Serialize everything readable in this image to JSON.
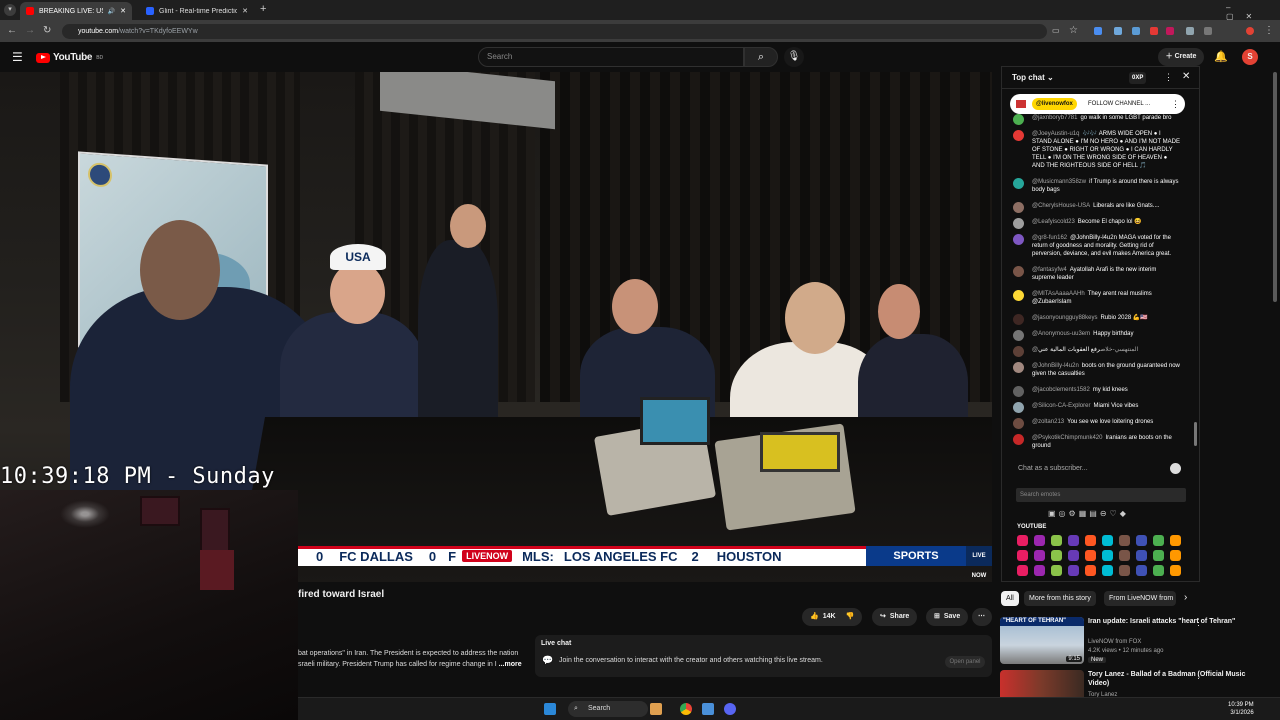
{
  "browser": {
    "tabs": [
      {
        "label": "BREAKING LIVE: US strikes I",
        "active": true,
        "audio": "🔊"
      },
      {
        "label": "Glint - Real-time Prediction Ma",
        "active": false
      }
    ],
    "new_tab": "+",
    "url_host": "youtube.com",
    "url_path": "/watch?v=TKdyfoEEWYw"
  },
  "youtube": {
    "logo_text": "YouTube",
    "logo_sup": "BD",
    "search_placeholder": "Search",
    "create_label": "Create",
    "avatar_letter": "S"
  },
  "video": {
    "overlay_time": "10:39:18 PM - Sunday",
    "ticker": {
      "items": [
        "0",
        "FC DALLAS",
        "0",
        "F",
        "MLS:",
        "LOS ANGELES FC",
        "2",
        "HOUSTON"
      ],
      "network": "LIVENOW",
      "sports": "SPORTS",
      "bug": "LIVE NOW"
    },
    "cap_text": "USA"
  },
  "below_video": {
    "title_fragment": "fired toward Israel",
    "actions": {
      "likes": "14K",
      "share": "Share",
      "save": "Save"
    },
    "description_line1": "bat operations\" in Iran. The President is expected to address the nation",
    "description_line2": "sraeli military. President Trump has called for regime change in I",
    "more": "...more",
    "live_chat_title": "Live chat",
    "live_chat_text": "Join the conversation to interact with the creator and others watching this live stream.",
    "open_panel": "Open panel"
  },
  "chat": {
    "header": "Top chat",
    "xp": "0XP",
    "pinned_user": "@livenowfox",
    "pinned_label": "FOLLOW CHANNEL ...",
    "messages": [
      {
        "user": "@jaxnboryb7781",
        "text": "go walk in some LGBT parade bro",
        "color": "#4caf50"
      },
      {
        "user": "@JoeyAustin-u1q",
        "text": "🎶🎶 ARMS WIDE OPEN ● I STAND ALONE ● I'M NO HERO ● AND I'M NOT MADE OF STONE ● RIGHT OR WRONG ● I CAN HARDLY TELL ● I'M ON THE WRONG SIDE OF HEAVEN ● AND THE RIGHTEOUS SIDE OF HELL 🎵",
        "color": "#e53935"
      },
      {
        "user": "@Musicmann358zw",
        "text": "if Trump is around there is always body bags",
        "color": "#26a69a"
      },
      {
        "user": "@CherylsHouse-USA",
        "text": "Liberals are like Gnats....",
        "color": "#8d6e63"
      },
      {
        "user": "@Leafyiscold23",
        "text": "Become El chapo lol 😆",
        "color": "#9e9e9e"
      },
      {
        "user": "@gr8-fun162",
        "text": "@JohnBilly-l4u2n MAGA voted for the return of goodness and morality. Getting rid of perversion, deviance, and evil makes America great.",
        "color": "#7e57c2"
      },
      {
        "user": "@fantasyfw4",
        "text": "Ayatollah Arafi is the new interim supreme leader",
        "color": "#795548"
      },
      {
        "user": "@MITAsAaaaAAHh",
        "text": "They arent real muslims @ZubaerIslam",
        "color": "#fdd835"
      },
      {
        "user": "@jasonyoungguy88keys",
        "text": "Rubio 2028 💪🇺🇸",
        "color": "#3e2723"
      },
      {
        "user": "@Anonymous-uu3em",
        "text": "Happy birthday",
        "color": "#757575"
      },
      {
        "user": "@المنتهسي-خلاص",
        "text": "رفع العقوبات المالية عني",
        "color": "#5d4037"
      },
      {
        "user": "@JohnBilly-l4u2n",
        "text": "boots on the ground guaranteed now given the casualties",
        "color": "#a1887f"
      },
      {
        "user": "@jacobclements1582",
        "text": "my kid knees",
        "color": "#616161"
      },
      {
        "user": "@Silicon-CA-Explorer",
        "text": "Miami Vice vibes",
        "color": "#90a4ae"
      },
      {
        "user": "@zoltan213",
        "text": "You see we love loitering drones",
        "color": "#6d4c41"
      },
      {
        "user": "@PsykotikChimpmunk420",
        "text": "Iranians are boots on the ground",
        "color": "#c62828"
      }
    ],
    "input_placeholder": "Chat as a subscriber...",
    "emote_search": "Search emotes",
    "emote_section": "YOUTUBE"
  },
  "sidebar": {
    "chips": [
      "All",
      "More from this story",
      "From LiveNOW from"
    ],
    "recommendations": [
      {
        "title": "Iran update: Israeli attacks \"heart of Tehran\"",
        "channel": "LiveNOW from FOX",
        "meta": "4.2K views • 12 minutes ago",
        "badge": "New",
        "duration": "9:15",
        "thumb_text": "\"HEART OF TEHRAN\""
      },
      {
        "title": "Tory Lanez - Ballad of a Badman (Official Music Video)",
        "channel": "Tory Lanez",
        "meta": "",
        "badge": "",
        "duration": "",
        "thumb_text": ""
      }
    ]
  },
  "taskbar": {
    "search": "Search",
    "time": "10:39 PM",
    "date": "3/1/2026"
  }
}
